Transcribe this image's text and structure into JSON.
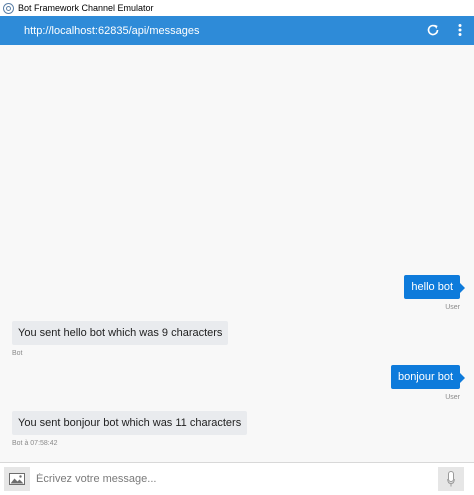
{
  "window": {
    "title": "Bot Framework Channel Emulator"
  },
  "addressbar": {
    "url": "http://localhost:62835/api/messages",
    "refresh_icon": "refresh-icon",
    "more_icon": "more-vertical-icon"
  },
  "colors": {
    "accent": "#2e8bd8",
    "user_bubble": "#0e7bdb",
    "bot_bubble": "#e9ebee",
    "chat_background": "#f8f8f8"
  },
  "messages": [
    {
      "from": "user",
      "text": "hello bot",
      "meta": "User"
    },
    {
      "from": "bot",
      "text": "You sent hello bot which was 9 characters",
      "meta": "Bot"
    },
    {
      "from": "user",
      "text": "bonjour bot",
      "meta": "User"
    },
    {
      "from": "bot",
      "text": "You sent bonjour bot which was 11 characters",
      "meta": "Bot à 07:58:42"
    }
  ],
  "input": {
    "placeholder": "Écrivez votre message...",
    "value": "",
    "image_icon": "image-icon",
    "mic_icon": "microphone-icon"
  }
}
